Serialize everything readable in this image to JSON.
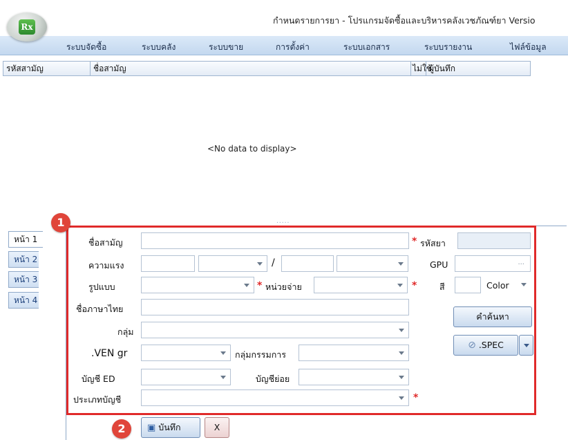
{
  "window": {
    "logo_text": "Rx",
    "title": "กำหนดรายการยา - โปรแกรมจัดซื้อและบริหารคลังเวชภัณฑ์ยา Versio"
  },
  "menu": {
    "items": [
      "ระบบจัดซื้อ",
      "ระบบคลัง",
      "ระบบขาย",
      "การตั้งค่า",
      "ระบบเอกสาร",
      "ระบบรายงาน",
      "ไฟล์ข้อมูล"
    ]
  },
  "grid": {
    "columns": [
      "รหัสสามัญ",
      "ชื่อสามัญ",
      "ไม่ใช้",
      "ผู้บันทึก"
    ],
    "empty_text": "<No data to display>",
    "splitter_dots": "....."
  },
  "tabs": [
    "หน้า 1",
    "หน้า 2",
    "หน้า 3",
    "หน้า 4"
  ],
  "badges": {
    "form": "1",
    "save": "2"
  },
  "form": {
    "generic_name_label": "ชื่อสามัญ",
    "drug_code_label": "รหัสยา",
    "strength_label": "ความแรง",
    "strength_separator": "/",
    "gpu_label": "GPU",
    "gpu_ellipsis": "...",
    "dosage_form_label": "รูปแบบ",
    "unit_label": "หน่วยจ่าย",
    "color_label": "สี",
    "color_value": "Color",
    "thai_name_label": "ชื่อภาษาไทย",
    "search_word_button": "คำค้นหา",
    "group_label": "กลุ่ม",
    "ven_label": ".VEN gr",
    "committee_group_label": "กลุ่มกรรมการ",
    "spec_button": ".SPEC",
    "ed_label": "บัญชี ED",
    "sub_account_label": "บัญชีย่อย",
    "account_type_label": "ประเภทบัญชี",
    "required_mark": "*"
  },
  "footer": {
    "save_label": "บันทึก",
    "cancel_label": "X"
  }
}
